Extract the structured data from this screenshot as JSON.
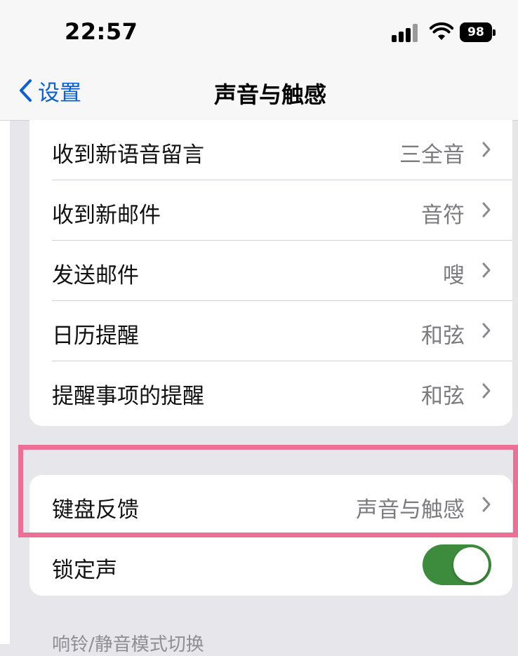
{
  "status_bar": {
    "time": "22:57",
    "battery": "98",
    "icons": [
      "cellular-signal-icon",
      "wifi-icon",
      "battery-icon"
    ]
  },
  "nav": {
    "back_label": "设置",
    "title": "声音与触感"
  },
  "sounds_group": [
    {
      "label": "收到新语音留言",
      "value": "三全音"
    },
    {
      "label": "收到新邮件",
      "value": "音符"
    },
    {
      "label": "发送邮件",
      "value": "嗖"
    },
    {
      "label": "日历提醒",
      "value": "和弦"
    },
    {
      "label": "提醒事项的提醒",
      "value": "和弦"
    }
  ],
  "keyboard_group": {
    "keyboard_feedback": {
      "label": "键盘反馈",
      "value": "声音与触感"
    },
    "lock_sound": {
      "label": "锁定声",
      "enabled": true
    }
  },
  "footer_partial": "响铃/静音模式切换",
  "colors": {
    "accent_blue": "#0a60d6",
    "toggle_green": "#3d8b3d",
    "highlight_pink": "#ec7096",
    "secondary_gray": "#7b7b80"
  }
}
